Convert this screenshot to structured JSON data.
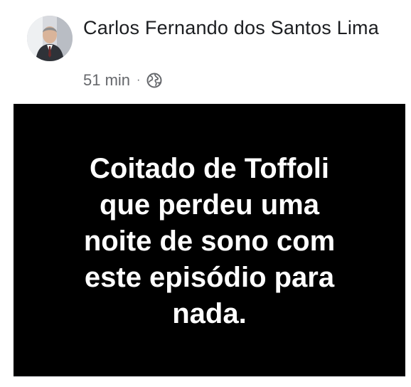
{
  "post": {
    "author_name": "Carlos Fernando dos Santos Lima",
    "time": "51 min",
    "separator": "·",
    "privacy_icon": "globe-icon",
    "card_text": "Coitado de Toffoli\nque perdeu uma\nnoite de sono com\neste episódio para\nnada.",
    "card_background": "#000000",
    "card_text_color": "#ffffff"
  }
}
